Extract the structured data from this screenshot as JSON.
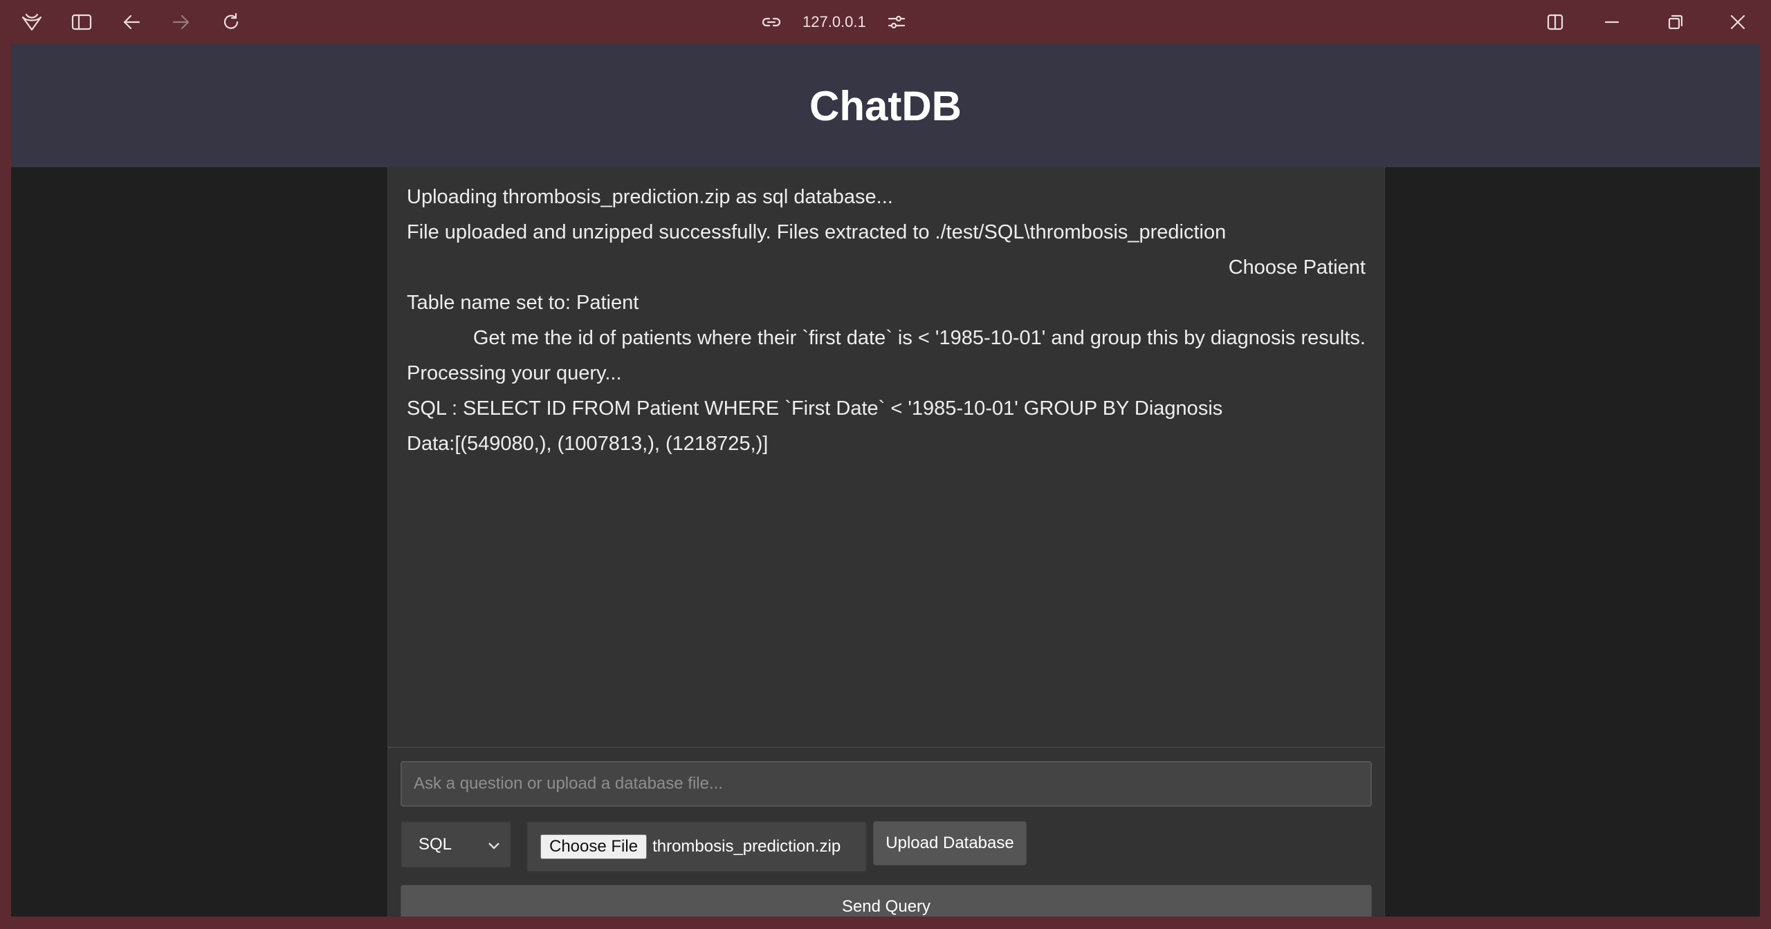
{
  "browser": {
    "address": "127.0.0.1"
  },
  "app": {
    "title": "ChatDB"
  },
  "messages": [
    {
      "role": "system",
      "text": "Uploading thrombosis_prediction.zip as sql database..."
    },
    {
      "role": "system",
      "text": "File uploaded and unzipped successfully. Files extracted to ./test/SQL\\thrombosis_prediction"
    },
    {
      "role": "user",
      "text": "Choose Patient"
    },
    {
      "role": "system",
      "text": "Table name set to: Patient"
    },
    {
      "role": "user",
      "text": "Get me the id of patients where their `first date` is < '1985-10-01' and group this by diagnosis results."
    },
    {
      "role": "system",
      "text": "Processing your query..."
    },
    {
      "role": "system",
      "text": "SQL : SELECT ID FROM Patient WHERE `First Date` < '1985-10-01' GROUP BY Diagnosis"
    },
    {
      "role": "system",
      "text": "Data:[(549080,), (1007813,), (1218725,)]"
    }
  ],
  "input": {
    "placeholder": "Ask a question or upload a database file...",
    "value": ""
  },
  "db_type": {
    "selected": "SQL"
  },
  "file": {
    "button_label": "Choose File",
    "file_name": "thrombosis_prediction.zip"
  },
  "upload_label": "Upload Database",
  "send_label": "Send Query"
}
